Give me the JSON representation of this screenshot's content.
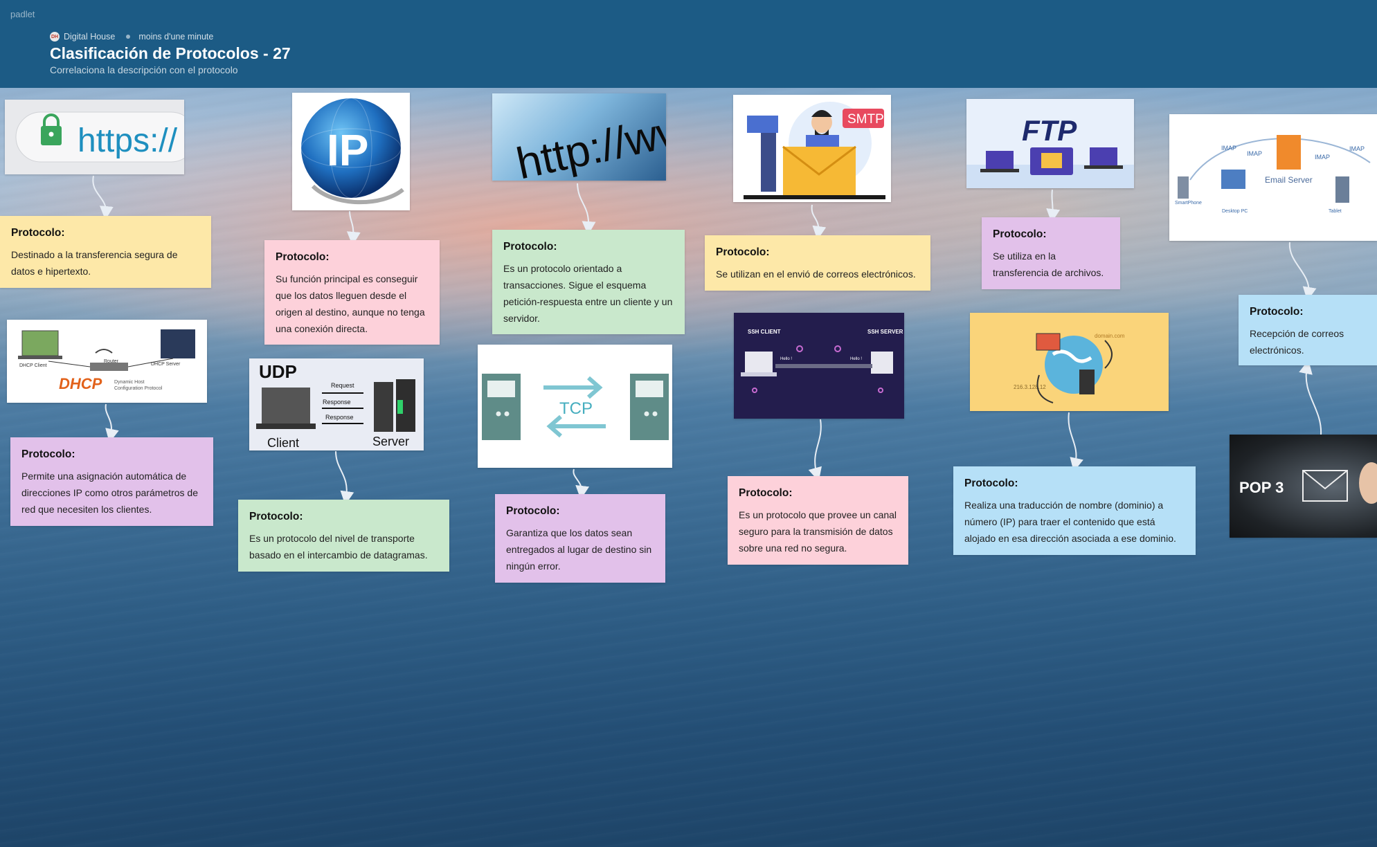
{
  "app": {
    "brand": "padlet"
  },
  "board": {
    "author": "Digital House",
    "timestamp": "moins d'une minute",
    "title": "Clasificación de Protocolos - 27",
    "subtitle": "Correlaciona la descripción con el protocolo"
  },
  "images": {
    "https": "https://",
    "ip": "IP",
    "http": "http://www",
    "smtp": "SMTP",
    "ftp": "FTP",
    "email_server": "Email Server",
    "imap": "IMAP",
    "smartphone": "SmartPhone",
    "desktop_pc": "Desktop PC",
    "tablet": "Tablet",
    "dhcp": "DHCP",
    "dhcp_sub1": "Dynamic Host",
    "dhcp_sub2": "Configuration Protocol",
    "dhcp_client": "DHCP Client",
    "dhcp_server": "DHCP Server",
    "router": "Router",
    "udp": "UDP",
    "request": "Request",
    "response": "Response",
    "client": "Client",
    "server": "Server",
    "tcp": "TCP",
    "ssh_client": "SSH CLIENT",
    "ssh_server": "SSH SERVER",
    "hello": "Hello !",
    "domain": "domain.com",
    "ip_addr": "216.3.128.12",
    "pop3": "POP 3"
  },
  "cards": [
    {
      "heading": "Protocolo:",
      "text": "Destinado a la transferencia segura de datos e hipertexto."
    },
    {
      "heading": "Protocolo:",
      "text": "Su función principal es conseguir que los datos lleguen desde el origen al destino, aunque no tenga una conexión directa."
    },
    {
      "heading": "Protocolo:",
      "text": "Es un protocolo orientado a transacciones. Sigue el esquema petición-respuesta entre un cliente y un servidor."
    },
    {
      "heading": "Protocolo:",
      "text": "Se utilizan en el envió de correos electrónicos."
    },
    {
      "heading": "Protocolo:",
      "text": "Se utiliza en la transferencia de archivos."
    },
    {
      "heading": "Protocolo:",
      "text": "Recepción de correos electrónicos."
    },
    {
      "heading": "Protocolo:",
      "text": "Permite una asignación automática de direcciones IP como otros parámetros de red que necesiten los clientes."
    },
    {
      "heading": "Protocolo:",
      "text": "Es un protocolo del nivel de transporte basado en el intercambio de datagramas."
    },
    {
      "heading": "Protocolo:",
      "text": "Garantiza que los datos sean entregados al lugar de destino sin ningún error."
    },
    {
      "heading": "Protocolo:",
      "text": "Es un protocolo que provee un canal seguro para la transmisión de datos sobre una red no segura."
    },
    {
      "heading": "Protocolo:",
      "text": "Realiza una traducción de nombre (dominio) a número (IP) para traer el contenido que está alojado en esa dirección asociada a ese dominio."
    }
  ]
}
